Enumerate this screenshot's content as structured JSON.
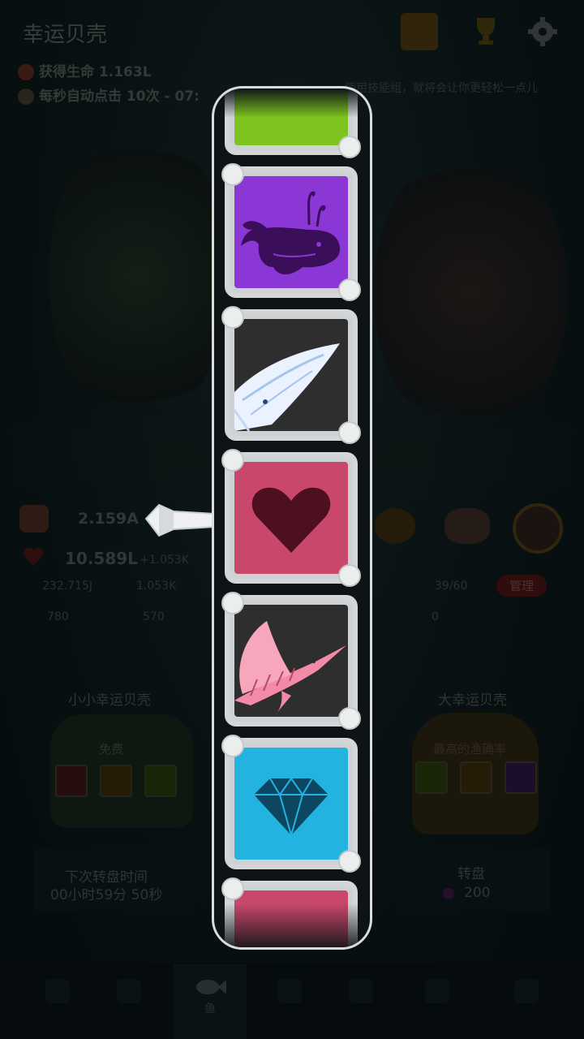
{
  "header": {
    "title": "幸运贝壳",
    "life_gain": "获得生命 1.163L",
    "auto_click": "每秒自动点击 10次 - 07:",
    "hint_fragment": "使用技能组，就将会让你更轻松一点儿"
  },
  "stats": {
    "primary_value": "2.159A",
    "hearts_value": "10.589L",
    "hearts_rate": "+1.053K",
    "stat_a": "232.715J",
    "stat_b": "1.053K",
    "stat_c": "780",
    "stat_d": "570",
    "capacity": "39/60",
    "stat_e": "0",
    "manage_label": "管理"
  },
  "left_panel": {
    "title": "小小幸运贝壳",
    "free_label": "免费",
    "next_spin_label": "下次转盘时间",
    "next_spin_time": "00小时59分 50秒"
  },
  "right_panel": {
    "title": "大幸运贝壳",
    "best_rate_label": "最高的渔确率",
    "spin_label": "转盘",
    "spin_cost": "200"
  },
  "bottom_nav": {
    "active_tab_label": "鱼"
  },
  "reel": {
    "tiles": [
      {
        "name": "partial-green-tile",
        "color": "#7dc41e"
      },
      {
        "name": "whale-tile",
        "color": "#8a37d6",
        "icon": "whale-icon"
      },
      {
        "name": "blue-whale-tile",
        "color": "#2e2e2e",
        "icon": "blue-whale-icon"
      },
      {
        "name": "heart-tile",
        "color": "#c9476a",
        "icon": "heart-icon"
      },
      {
        "name": "sailfish-tile",
        "color": "#2e2e2e",
        "icon": "sailfish-icon"
      },
      {
        "name": "diamond-tile",
        "color": "#23b3e1",
        "icon": "diamond-icon"
      },
      {
        "name": "partial-pink-tile",
        "color": "#c9476a"
      }
    ]
  },
  "colors": {
    "tile_border": "#d4d6d8",
    "purple_face": "#8a37d6",
    "pink_face": "#c9476a",
    "cyan_face": "#23b3e1",
    "dark_face": "#2e2e2e",
    "green_face": "#7dc41e"
  }
}
